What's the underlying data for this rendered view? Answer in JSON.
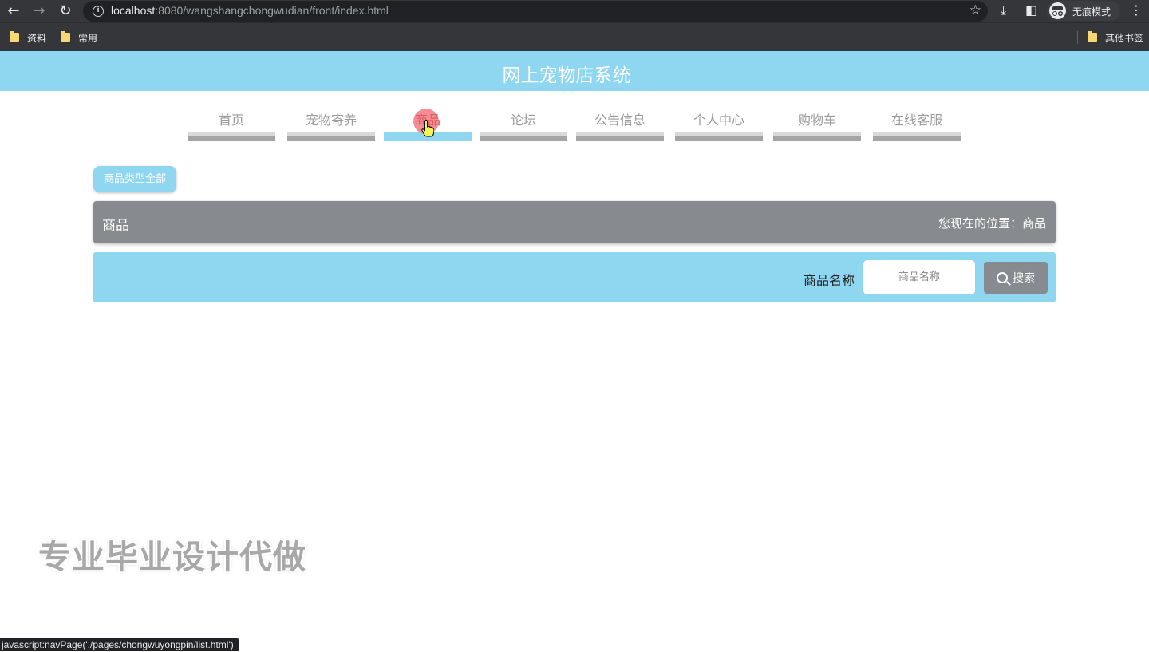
{
  "browser": {
    "url_host": "localhost",
    "url_rest": ":8080/wangshangchongwudian/front/index.html",
    "incognito_label": "无痕模式",
    "bookmarks": [
      {
        "label": "资料"
      },
      {
        "label": "常用"
      }
    ],
    "other_bookmarks": "其他书签",
    "status_url": "javascript:navPage('./pages/chongwuyongpin/list.html')"
  },
  "site": {
    "title": "网上宠物店系统"
  },
  "nav": {
    "items": [
      {
        "label": "首页"
      },
      {
        "label": "宠物寄养"
      },
      {
        "label": "商品",
        "active": true
      },
      {
        "label": "论坛"
      },
      {
        "label": "公告信息"
      },
      {
        "label": "个人中心"
      },
      {
        "label": "购物车"
      },
      {
        "label": "在线客服"
      }
    ]
  },
  "category": {
    "button_label": "商品类型全部"
  },
  "breadcrumb": {
    "title": "商品",
    "location": "您现在的位置：商品"
  },
  "search": {
    "label": "商品名称",
    "placeholder": "商品名称",
    "button_label": "搜索"
  },
  "watermark": "专业毕业设计代做",
  "colors": {
    "accent": "#8fd6f1",
    "gray_bar": "#878a8e"
  }
}
